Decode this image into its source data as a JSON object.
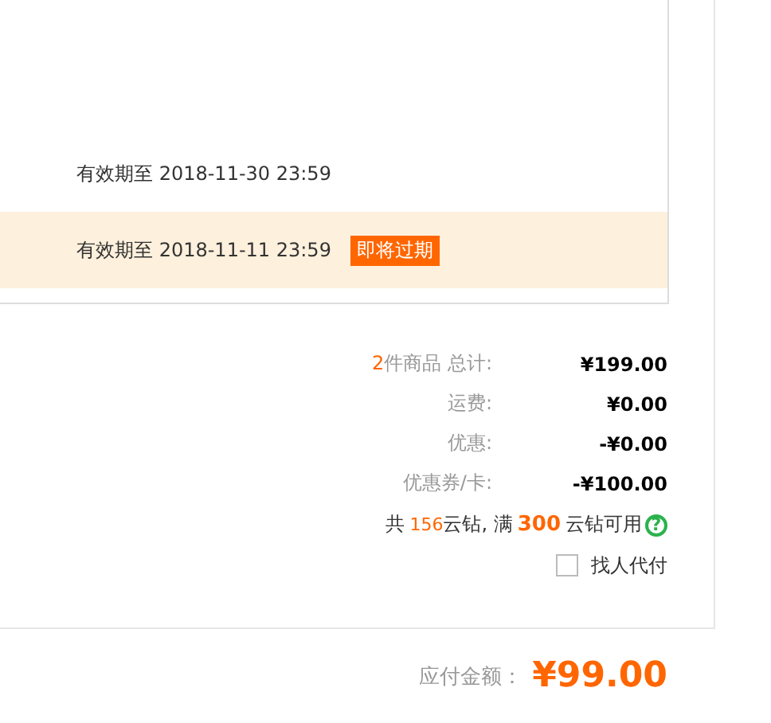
{
  "coupons": [
    {
      "validity": "有效期至 2018-11-30 23:59",
      "highlighted": false
    },
    {
      "validity": "有效期至 2018-11-11 23:59",
      "highlighted": true,
      "badge": "即将过期"
    }
  ],
  "summary": {
    "item_count": "2",
    "total_label": "件商品 总计:",
    "total_value": "¥199.00",
    "rows": [
      {
        "label": "运费:",
        "value": "¥0.00"
      },
      {
        "label": "优惠:",
        "value": "-¥0.00"
      },
      {
        "label": "优惠券/卡:",
        "value": "-¥100.00"
      }
    ]
  },
  "diamonds": {
    "prefix": "共",
    "count": "156",
    "middle": "云钻, 满",
    "threshold": "300",
    "suffix": "云钻可用",
    "help": "?"
  },
  "pay_for_me": {
    "label": "找人代付",
    "checked": false
  },
  "payable": {
    "label": "应付金额：",
    "amount": "¥99.00"
  }
}
